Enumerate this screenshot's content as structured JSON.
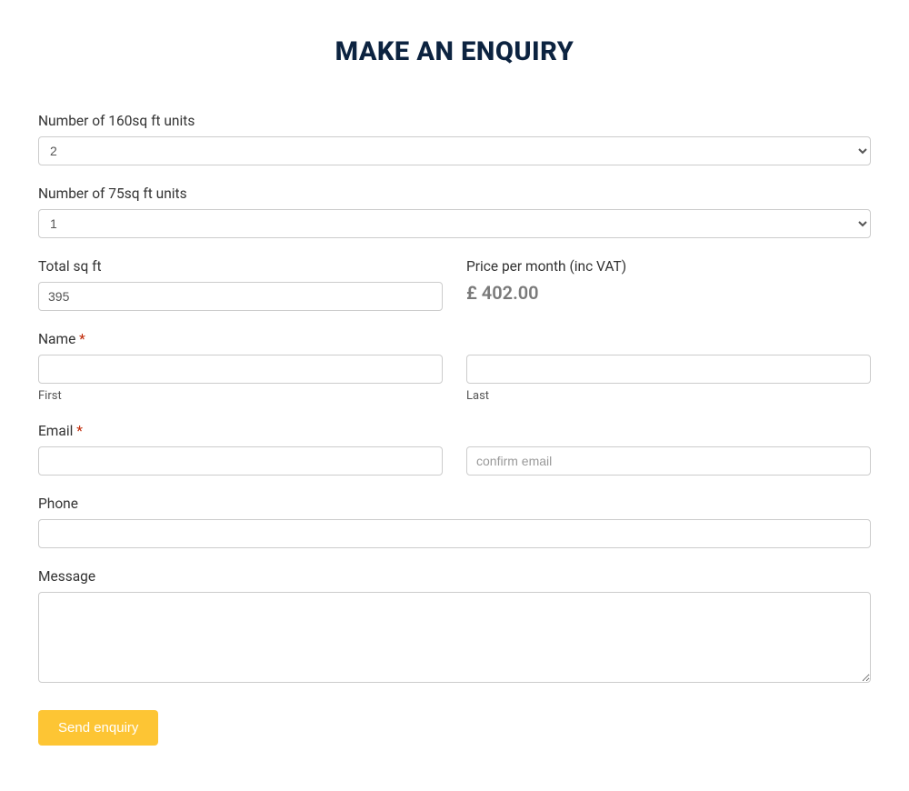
{
  "heading": "MAKE AN ENQUIRY",
  "units160": {
    "label": "Number of 160sq ft units",
    "value": "2"
  },
  "units75": {
    "label": "Number of 75sq ft units",
    "value": "1"
  },
  "total": {
    "label": "Total sq ft",
    "value": "395"
  },
  "price": {
    "label": "Price per month (inc VAT)",
    "display": "£ 402.00"
  },
  "name": {
    "label": "Name ",
    "first_sub": "First",
    "last_sub": "Last"
  },
  "email": {
    "label": "Email ",
    "confirm_placeholder": "confirm email"
  },
  "phone": {
    "label": "Phone"
  },
  "message": {
    "label": "Message"
  },
  "required_marker": "*",
  "submit_label": "Send enquiry"
}
